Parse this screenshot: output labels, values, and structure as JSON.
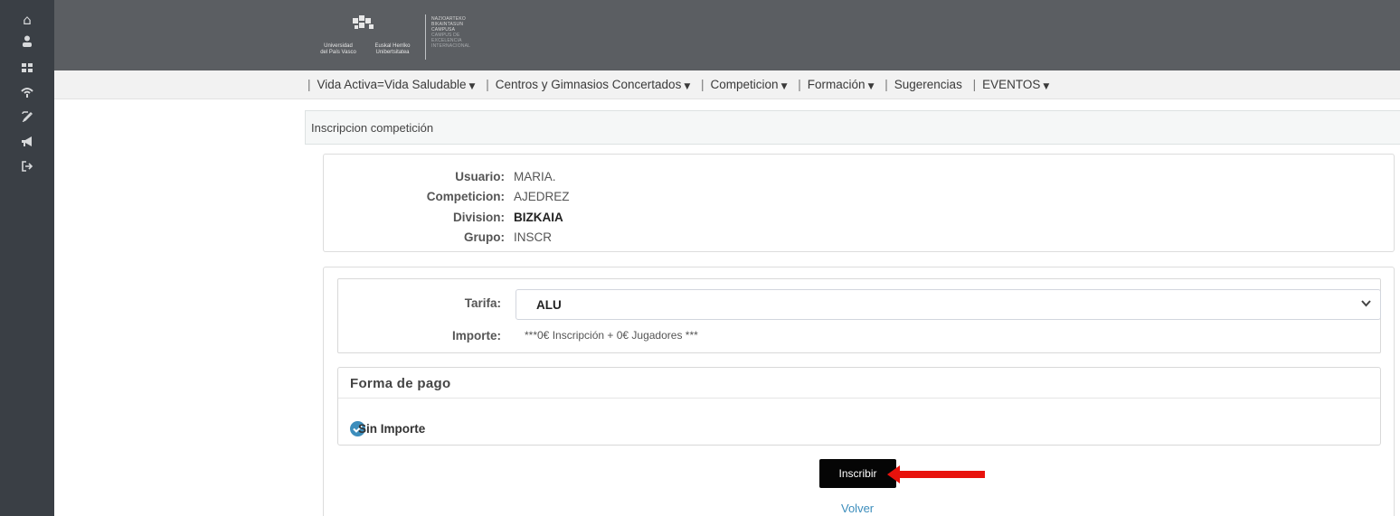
{
  "rail": {
    "icons": [
      "home-icon",
      "user-icon",
      "grid-icon",
      "broadcast-icon",
      "edit-icon",
      "megaphone-icon",
      "sign-out-icon"
    ]
  },
  "header": {
    "logo": {
      "name_es_line1": "Universidad",
      "name_es_line2": "del País Vasco",
      "name_eu_line1": "Euskal Herriko",
      "name_eu_line2": "Unibertsitatea",
      "campus_lines": [
        "NAZIOARTEKO",
        "BIKAINTASUN",
        "CAMPUSA",
        "CAMPUS DE",
        "EXCELENCIA",
        "INTERNACIONAL"
      ]
    }
  },
  "nav": {
    "items": [
      {
        "label": "Vida Activa=Vida Saludable",
        "dropdown": true
      },
      {
        "label": "Centros y Gimnasios Concertados",
        "dropdown": true
      },
      {
        "label": "Competicion",
        "dropdown": true
      },
      {
        "label": "Formación",
        "dropdown": true
      },
      {
        "label": "Sugerencias",
        "dropdown": false
      },
      {
        "label": "EVENTOS",
        "dropdown": true
      }
    ]
  },
  "panel": {
    "title": "Inscripcion competición"
  },
  "info": {
    "usuario_label": "Usuario:",
    "usuario_value": "MARIA.",
    "competicion_label": "Competicion:",
    "competicion_value": "AJEDREZ",
    "division_label": "Division:",
    "division_value": "BIZKAIA",
    "grupo_label": "Grupo:",
    "grupo_value": "INSCR"
  },
  "form": {
    "tarifa_label": "Tarifa:",
    "tarifa_value": "ALU",
    "importe_label": "Importe:",
    "importe_value": "***0€ Inscripción + 0€ Jugadores ***",
    "pago_title": "Forma de pago",
    "pago_option": "Sin Importe",
    "submit_label": "Inscribir",
    "back_label": "Volver"
  },
  "colors": {
    "rail": "#3a3f45",
    "header": "#5b5e62",
    "accent": "#3c8dbc",
    "arrow": "#e8120c"
  }
}
